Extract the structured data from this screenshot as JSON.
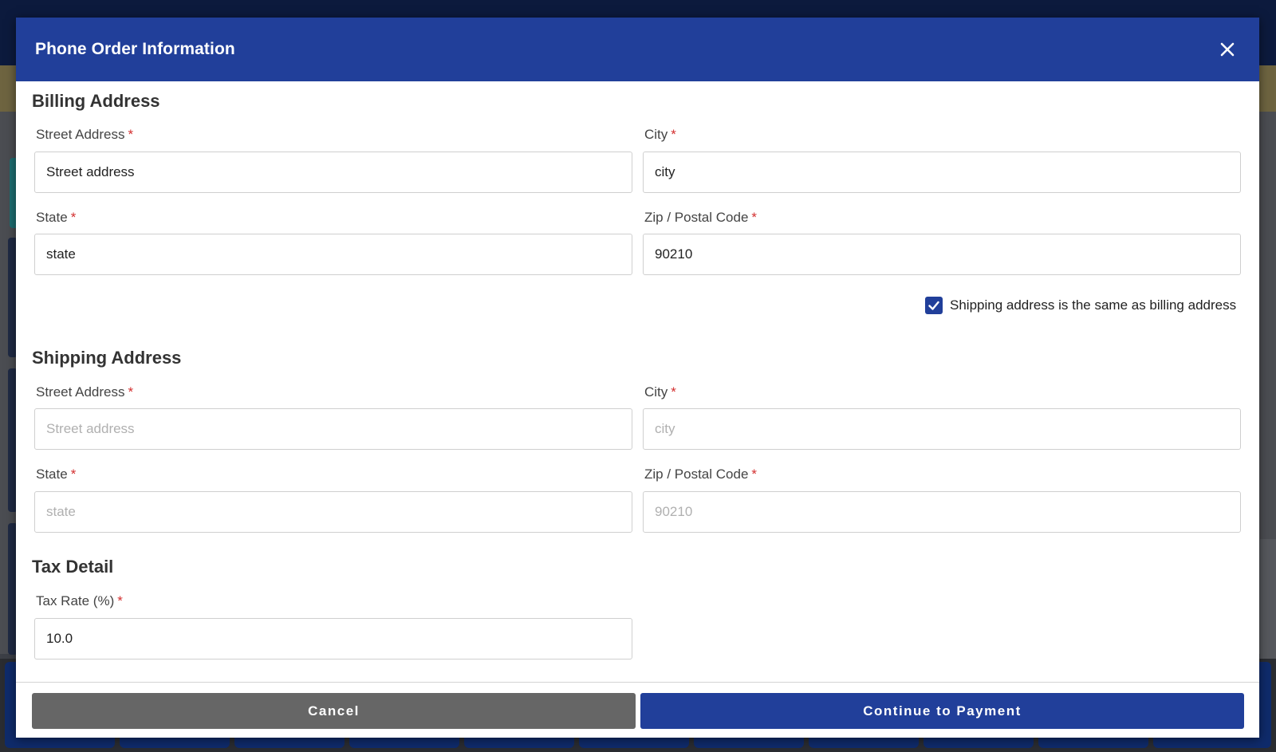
{
  "dialog": {
    "title": "Phone Order Information",
    "close_icon": "close-icon"
  },
  "billing": {
    "title": "Billing Address",
    "street_label": "Street Address",
    "street_value": "Street address",
    "city_label": "City",
    "city_value": "city",
    "state_label": "State",
    "state_value": "state",
    "zip_label": "Zip / Postal Code",
    "zip_value": "90210",
    "required_mark": "*"
  },
  "same_address": {
    "label": "Shipping address is the same as billing address",
    "checked": true
  },
  "shipping": {
    "title": "Shipping Address",
    "street_label": "Street Address",
    "street_placeholder": "Street address",
    "city_label": "City",
    "city_placeholder": "city",
    "state_label": "State",
    "state_placeholder": "state",
    "zip_label": "Zip / Postal Code",
    "zip_placeholder": "90210",
    "required_mark": "*"
  },
  "tax": {
    "title": "Tax Detail",
    "rate_label": "Tax Rate (%)",
    "rate_value": "10.0",
    "required_mark": "*"
  },
  "actions": {
    "cancel_label": "Cancel",
    "continue_label": "Continue to Payment"
  },
  "colors": {
    "primary": "#213f9a",
    "cancel": "#666666",
    "required": "#d32f2f"
  }
}
